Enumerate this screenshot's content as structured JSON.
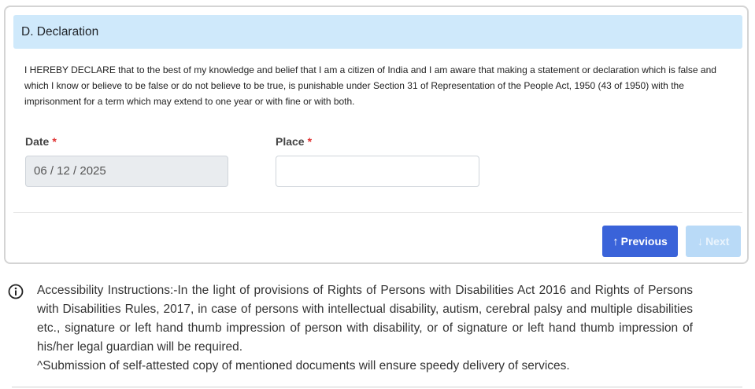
{
  "section": {
    "title": "D. Declaration",
    "declaration_text": "I HEREBY DECLARE that to the best of my knowledge and belief that I am a citizen of India and I am aware that making a statement or declaration which is false and which I know or believe to be false or do not believe to be true, is punishable under Section 31 of Representation of the People Act, 1950 (43 of 1950) with the imprisonment for a term which may extend to one year or with fine or with both."
  },
  "form": {
    "date_label": "Date",
    "date_value": "06 / 12 / 2025",
    "place_label": "Place",
    "place_value": "",
    "required_mark": "*"
  },
  "nav": {
    "previous_label": "Previous",
    "next_label": "Next",
    "previous_icon": "↑",
    "next_icon": "↓"
  },
  "footer": {
    "instructions": "Accessibility Instructions:-In the light of provisions of Rights of Persons with Disabilities Act 2016 and Rights of Persons with Disabilities Rules, 2017, in case of persons with intellectual disability, autism, cerebral palsy and multiple disabilities etc., signature or left hand thumb impression of person with disability, or of signature or left hand thumb impression of his/her legal guardian will be required.",
    "note": "^Submission of self-attested copy of mentioned documents will ensure speedy delivery of services."
  },
  "colors": {
    "header_bg": "#cfe9fb",
    "primary": "#3a63d9",
    "disabled": "#b9daf7",
    "required": "#e03131"
  }
}
